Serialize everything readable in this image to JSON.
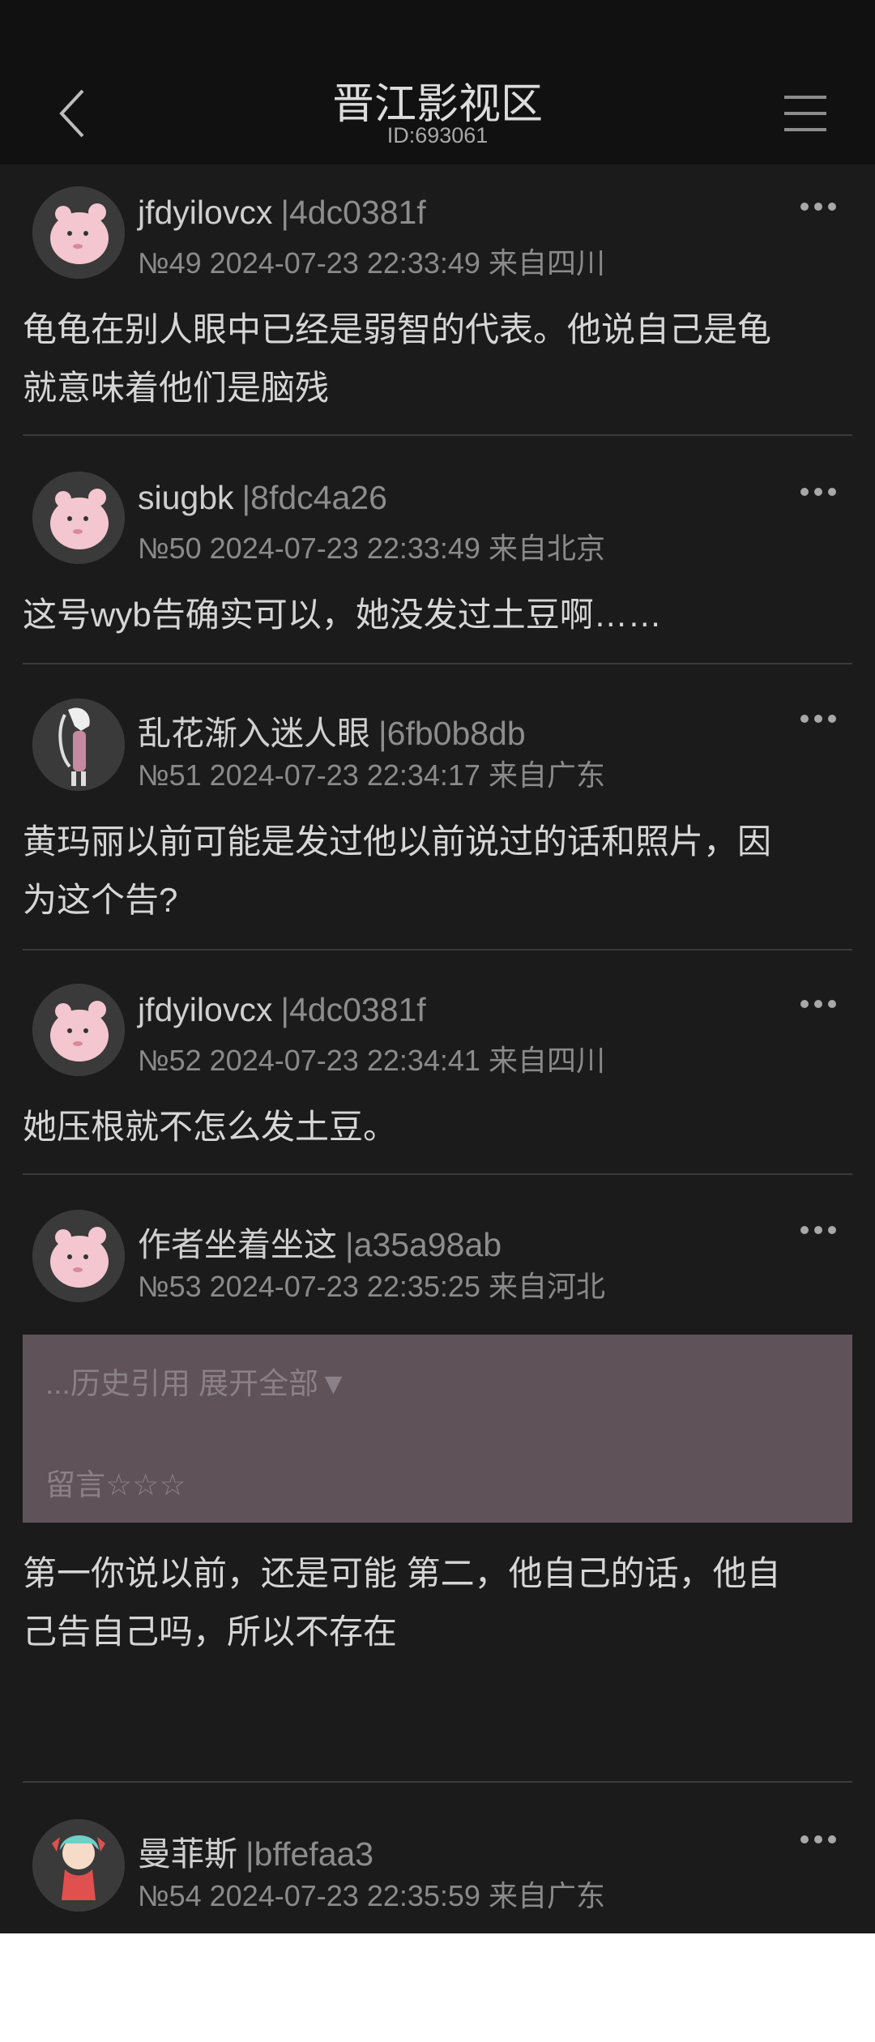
{
  "header": {
    "title": "晋江影视区",
    "subtitle": "ID:693061"
  },
  "quote": {
    "expand_text": "...历史引用 展开全部▼",
    "message": "留言☆☆☆"
  },
  "posts": [
    {
      "author": "jfdyilovcx",
      "uid": "|4dc0381f",
      "meta": "№49 2024-07-23 22:33:49 来自四川",
      "lines": [
        "龟龟在别人眼中已经是弱智的代表。他说自己是龟",
        "就意味着他们是脑残"
      ]
    },
    {
      "author": "siugbk",
      "uid": "|8fdc4a26",
      "meta": "№50 2024-07-23 22:33:49 来自北京",
      "lines": [
        "这号wyb告确实可以，她没发过土豆啊……"
      ]
    },
    {
      "author": "乱花渐入迷人眼",
      "uid": "|6fb0b8db",
      "meta": "№51 2024-07-23 22:34:17 来自广东",
      "lines": [
        "黄玛丽以前可能是发过他以前说过的话和照片，因",
        "为这个告?"
      ]
    },
    {
      "author": "jfdyilovcx",
      "uid": "|4dc0381f",
      "meta": "№52 2024-07-23 22:34:41 来自四川",
      "lines": [
        "她压根就不怎么发土豆。"
      ]
    },
    {
      "author": "作者坐着坐这",
      "uid": "|a35a98ab",
      "meta": "№53 2024-07-23 22:35:25 来自河北",
      "lines": [
        "第一你说以前，还是可能 第二，他自己的话，他自",
        "己告自己吗，所以不存在"
      ]
    },
    {
      "author": "曼菲斯",
      "uid": "|bffefaa3",
      "meta": "№54 2024-07-23 22:35:59 来自广东",
      "lines": []
    }
  ]
}
